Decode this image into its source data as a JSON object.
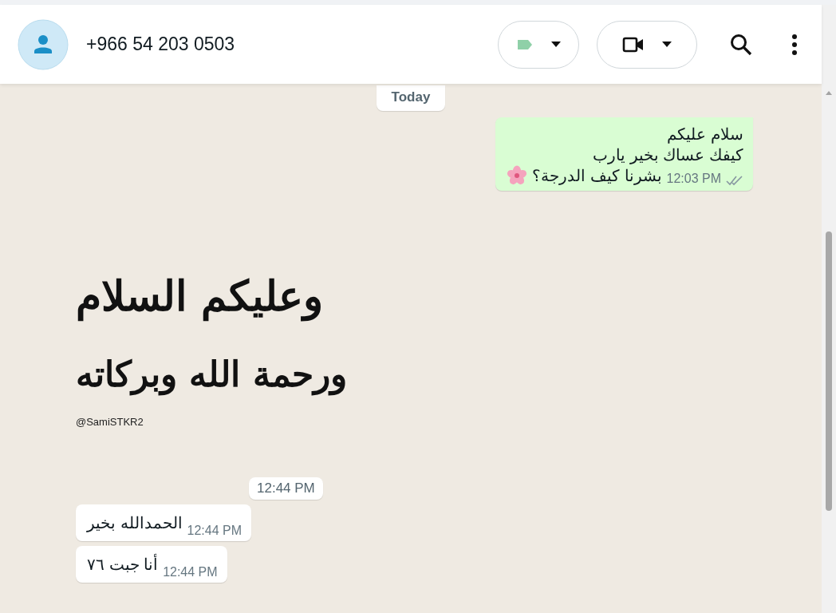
{
  "header": {
    "contact": "+966 54 203 0503"
  },
  "date_divider": "Today",
  "messages": [
    {
      "kind": "outgoing",
      "lines": [
        "سلام عليكم",
        "كيفك  عساك بخير يارب",
        "بشرنا كيف الدرجة؟"
      ],
      "emoji": true,
      "time": "12:03 PM",
      "read": false
    },
    {
      "kind": "sticker",
      "lines": [
        "وعليكم السلام",
        "ورحمة الله وبركاته"
      ],
      "credit": "@SamiSTKR2",
      "time": "12:44 PM"
    },
    {
      "kind": "incoming",
      "lines": [
        "الحمدالله بخير"
      ],
      "time": "12:44 PM"
    },
    {
      "kind": "incoming",
      "lines": [
        "أنا جبت ٧٦"
      ],
      "time": "12:44 PM"
    }
  ]
}
